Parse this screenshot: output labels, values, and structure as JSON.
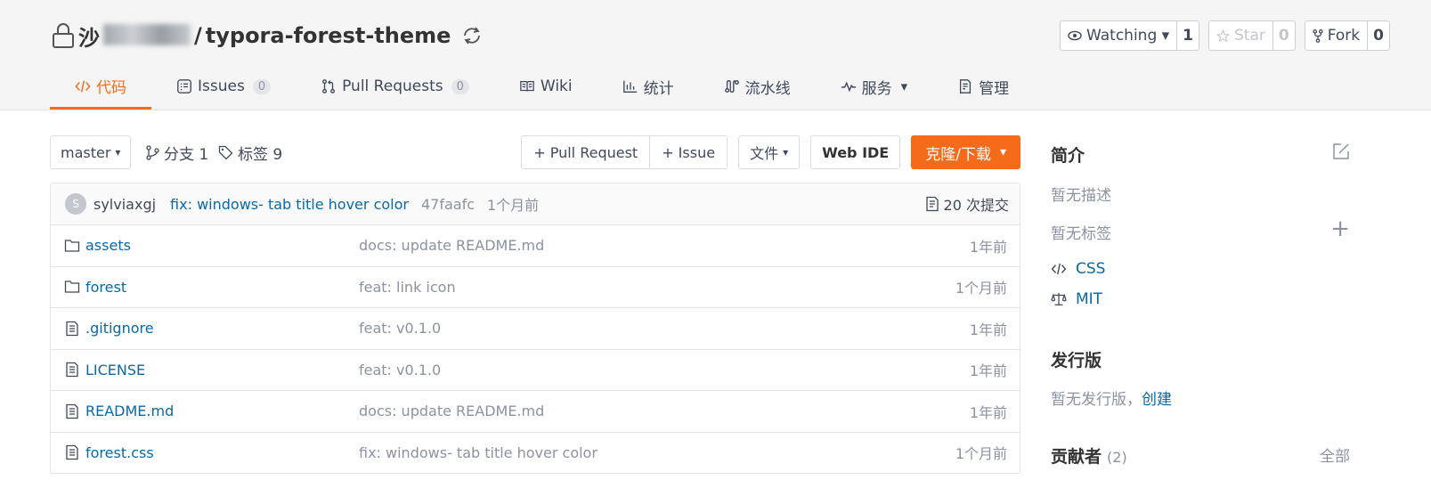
{
  "repo": {
    "owner_visible_prefix": "沙",
    "separator": "/",
    "name": "typora-forest-theme"
  },
  "actions": [
    {
      "label": "Watching ▾",
      "count": "1",
      "icon": "eye-icon",
      "disabled": false
    },
    {
      "label": "Star",
      "count": "0",
      "icon": "star-icon",
      "disabled": true
    },
    {
      "label": "Fork",
      "count": "0",
      "icon": "fork-icon",
      "disabled": false
    }
  ],
  "tabs": [
    {
      "label": "代码",
      "icon": "code-icon",
      "active": true
    },
    {
      "label": "Issues",
      "badge": "0",
      "icon": "issues-icon"
    },
    {
      "label": "Pull Requests",
      "badge": "0",
      "icon": "pull-request-icon"
    },
    {
      "label": "Wiki",
      "icon": "book-icon"
    },
    {
      "label": "统计",
      "icon": "chart-icon"
    },
    {
      "label": "流水线",
      "icon": "pipeline-icon"
    },
    {
      "label": "服务",
      "icon": "pulse-icon",
      "dropdown": "▾"
    },
    {
      "label": "管理",
      "icon": "settings-doc-icon"
    }
  ],
  "toolbar": {
    "branch": "master",
    "branch_caret": "▾",
    "branches": "分支 1",
    "tags": "标签 9",
    "pull_request": "+ Pull Request",
    "issue": "+ Issue",
    "file": "文件",
    "file_caret": "▾",
    "web_ide": "Web IDE",
    "clone": "克隆/下载",
    "clone_caret": "▾"
  },
  "commit": {
    "avatar_letter": "S",
    "author": "sylviaxgj",
    "message": "fix: windows- tab title hover color",
    "sha": "47faafc",
    "time": "1个月前",
    "count": "20 次提交"
  },
  "files": [
    {
      "type": "folder",
      "name": "assets",
      "message": "docs: update README.md",
      "time": "1年前"
    },
    {
      "type": "folder",
      "name": "forest",
      "message": "feat: link icon",
      "time": "1个月前"
    },
    {
      "type": "file",
      "name": ".gitignore",
      "message": "feat: v0.1.0",
      "time": "1年前"
    },
    {
      "type": "file",
      "name": "LICENSE",
      "message": "feat: v0.1.0",
      "time": "1年前"
    },
    {
      "type": "file",
      "name": "README.md",
      "message": "docs: update README.md",
      "time": "1年前"
    },
    {
      "type": "file",
      "name": "forest.css",
      "message": "fix: windows- tab title hover color",
      "time": "1个月前"
    }
  ],
  "sidebar": {
    "intro_title": "简介",
    "no_description": "暂无描述",
    "no_tags": "暂无标签",
    "add": "+",
    "language": "CSS",
    "license": "MIT",
    "releases_title": "发行版",
    "no_releases": "暂无发行版，",
    "create": "创建",
    "contributors_title": "贡献者",
    "contributors_count": "(2)",
    "all": "全部"
  },
  "colors": {
    "accent": "#f66b1a",
    "link": "#0969a8",
    "muted": "#8c92a4"
  }
}
